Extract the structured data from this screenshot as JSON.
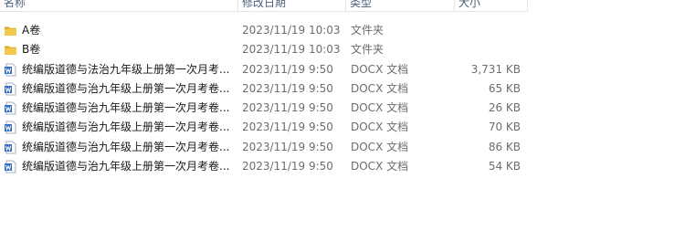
{
  "columns": {
    "name": "名称",
    "date": "修改日期",
    "type": "类型",
    "size": "大小"
  },
  "files": [
    {
      "icon": "folder-icon",
      "name": "A卷",
      "date": "2023/11/19 10:03",
      "type": "文件夹",
      "size": ""
    },
    {
      "icon": "folder-icon",
      "name": "B卷",
      "date": "2023/11/19 10:03",
      "type": "文件夹",
      "size": ""
    },
    {
      "icon": "docx-icon",
      "name": "统编版道德与法治九年级上册第一次月考...",
      "date": "2023/11/19 9:50",
      "type": "DOCX 文档",
      "size": "3,731 KB"
    },
    {
      "icon": "docx-icon",
      "name": "统编版道德与治九年级上册第一次月考卷...",
      "date": "2023/11/19 9:50",
      "type": "DOCX 文档",
      "size": "65 KB"
    },
    {
      "icon": "docx-icon",
      "name": "统编版道德与治九年级上册第一次月考卷...",
      "date": "2023/11/19 9:50",
      "type": "DOCX 文档",
      "size": "26 KB"
    },
    {
      "icon": "docx-icon",
      "name": "统编版道德与治九年级上册第一次月考卷...",
      "date": "2023/11/19 9:50",
      "type": "DOCX 文档",
      "size": "70 KB"
    },
    {
      "icon": "docx-icon",
      "name": "统编版道德与治九年级上册第一次月考卷...",
      "date": "2023/11/19 9:50",
      "type": "DOCX 文档",
      "size": "86 KB"
    },
    {
      "icon": "docx-icon",
      "name": "统编版道德与治九年级上册第一次月考卷...",
      "date": "2023/11/19 9:50",
      "type": "DOCX 文档",
      "size": "54 KB"
    }
  ],
  "colors": {
    "folder": "#f2c94c",
    "folder_dark": "#d9a521",
    "word_blue": "#2b6cc4"
  }
}
